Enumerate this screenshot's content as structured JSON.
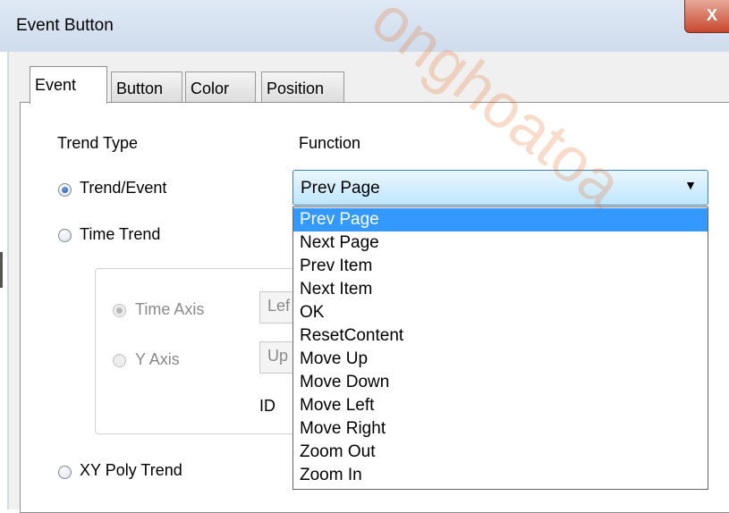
{
  "window": {
    "title": "Event Button",
    "close_label": "X"
  },
  "tabs": [
    {
      "label": "Event",
      "active": true
    },
    {
      "label": "Button",
      "active": false
    },
    {
      "label": "Color",
      "active": false
    },
    {
      "label": "Position",
      "active": false
    }
  ],
  "trend_type": {
    "heading": "Trend Type",
    "options": [
      {
        "label": "Trend/Event",
        "checked": true
      },
      {
        "label": "Time Trend",
        "checked": false
      },
      {
        "label": "XY Poly Trend",
        "checked": false
      }
    ]
  },
  "time_trend_group": {
    "time_axis": {
      "label": "Time Axis",
      "checked": true,
      "value": "Lef"
    },
    "y_axis": {
      "label": "Y Axis",
      "checked": false,
      "value": "Up"
    },
    "id_label": "ID"
  },
  "function": {
    "heading": "Function",
    "selected": "Prev Page",
    "options": [
      "Prev Page",
      "Next Page",
      "Prev Item",
      "Next Item",
      "OK",
      "ResetContent",
      "Move Up",
      "Move Down",
      "Move Left",
      "Move Right",
      "Zoom Out",
      "Zoom In"
    ]
  },
  "watermark": "onghoatoa"
}
